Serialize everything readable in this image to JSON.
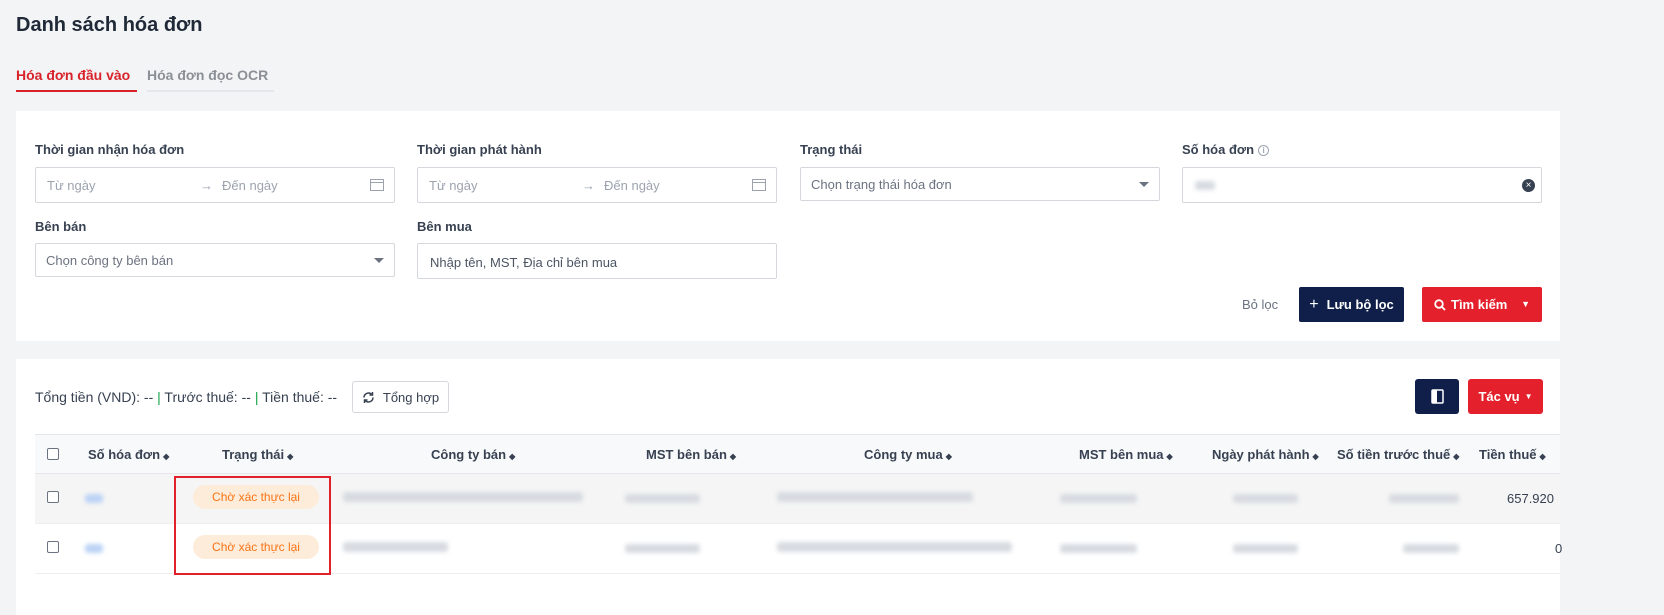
{
  "page": {
    "title": "Danh sách hóa đơn"
  },
  "tabs": [
    {
      "label": "Hóa đơn đầu vào",
      "active": true
    },
    {
      "label": "Hóa đơn đọc OCR",
      "active": false
    }
  ],
  "filters": {
    "receive_time": {
      "label": "Thời gian nhận hóa đơn",
      "from": "Từ ngày",
      "to": "Đến ngày",
      "arrow": "→"
    },
    "issue_time": {
      "label": "Thời gian phát hành",
      "from": "Từ ngày",
      "to": "Đến ngày",
      "arrow": "→"
    },
    "status": {
      "label": "Trạng thái",
      "placeholder": "Chọn trạng thái hóa đơn"
    },
    "invoice_no": {
      "label": "Số hóa đơn"
    },
    "seller": {
      "label": "Bên bán",
      "placeholder": "Chọn công ty bên bán"
    },
    "buyer": {
      "label": "Bên mua",
      "placeholder": "Nhập tên, MST, Địa chỉ bên mua"
    },
    "clear_label": "Bỏ lọc",
    "save_label": "Lưu bộ lọc",
    "search_label": "Tìm kiếm"
  },
  "summary": {
    "total": "Tổng tiền (VND): --",
    "pre_tax": "Trước thuế: --",
    "tax": "Tiền thuế: --",
    "separator": "|",
    "aggregate_label": "Tổng hợp"
  },
  "toolbar": {
    "actions_label": "Tác vụ"
  },
  "table": {
    "columns": [
      "Số hóa đơn",
      "Trạng thái",
      "Công ty bán",
      "MST bên bán",
      "Công ty mua",
      "MST bên mua",
      "Ngày phát hành",
      "Số tiền trước thuế",
      "Tiền thuế"
    ],
    "rows": [
      {
        "status": "Chờ xác thực lại",
        "tax": "657.920"
      },
      {
        "status": "Chờ xác thực lại",
        "tax": "0"
      }
    ]
  },
  "colors": {
    "accent": "#e3202b",
    "navy": "#0f1f4a",
    "badge_bg": "#fdecd9",
    "badge_text": "#f97316"
  }
}
